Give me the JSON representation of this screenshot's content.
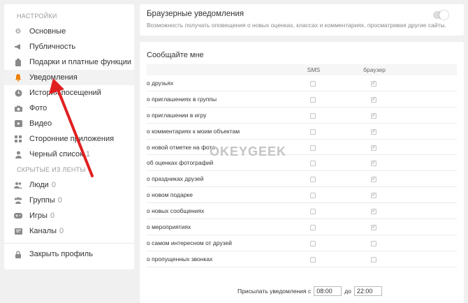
{
  "sidebar": {
    "settings_heading": "НАСТРОЙКИ",
    "items": [
      {
        "label": "Основные",
        "icon": "gear-icon"
      },
      {
        "label": "Публичность",
        "icon": "megaphone-icon"
      },
      {
        "label": "Подарки и платные функции",
        "icon": "gift-icon"
      },
      {
        "label": "Уведомления",
        "icon": "bell-icon"
      },
      {
        "label": "История посещений",
        "icon": "clock-icon"
      },
      {
        "label": "Фото",
        "icon": "camera-icon"
      },
      {
        "label": "Видео",
        "icon": "video-icon"
      },
      {
        "label": "Сторонние приложения",
        "icon": "grid-icon"
      },
      {
        "label": "Черный список",
        "count": "1",
        "icon": "ban-icon"
      }
    ],
    "hidden_heading": "СКРЫТЫЕ ИЗ ЛЕНТЫ",
    "hidden_items": [
      {
        "label": "Люди",
        "count": "0",
        "icon": "people-icon"
      },
      {
        "label": "Группы",
        "count": "0",
        "icon": "groups-icon"
      },
      {
        "label": "Игры",
        "count": "0",
        "icon": "gamepad-icon"
      },
      {
        "label": "Каналы",
        "count": "0",
        "icon": "channels-icon"
      }
    ],
    "close_profile": "Закрыть профиль"
  },
  "browser_card": {
    "title": "Браузерные уведомления",
    "description": "Возможность получать оповещения о новых оценках, классах и комментариях, просматривая другие сайты.",
    "toggle_on": false
  },
  "notify": {
    "title": "Сообщайте мне",
    "col_sms": "SMS",
    "col_browser": "браузер",
    "rows": [
      {
        "label": "о друзьях",
        "sms": false,
        "browser": true
      },
      {
        "label": "о приглашениях в группы",
        "sms": false,
        "browser": true
      },
      {
        "label": "о приглашении в игру",
        "sms": false,
        "browser": true
      },
      {
        "label": "о комментариях к моим объектам",
        "sms": false,
        "browser": true
      },
      {
        "label": "о новой отметке на фото",
        "sms": false,
        "browser": true
      },
      {
        "label": "об оценках фотографий",
        "sms": false,
        "browser": true
      },
      {
        "label": "о праздниках друзей",
        "sms": false,
        "browser": true
      },
      {
        "label": "о новом подарке",
        "sms": false,
        "browser": true
      },
      {
        "label": "о новых сообщениях",
        "sms": false,
        "browser": true
      },
      {
        "label": "о мероприятиях",
        "sms": false,
        "browser": true
      },
      {
        "label": "о самом интересном от друзей",
        "sms": false,
        "browser": false
      },
      {
        "label": "о пропущенных звонках",
        "sms": false,
        "browser": false
      }
    ],
    "schedule_prefix": "Присылать уведомления с",
    "from_time": "08:00",
    "to_label": "до",
    "to_time": "22:00"
  },
  "watermark": "OKEYGEEK",
  "colors": {
    "accent": "#ee8208",
    "arrow": "#e02020"
  }
}
